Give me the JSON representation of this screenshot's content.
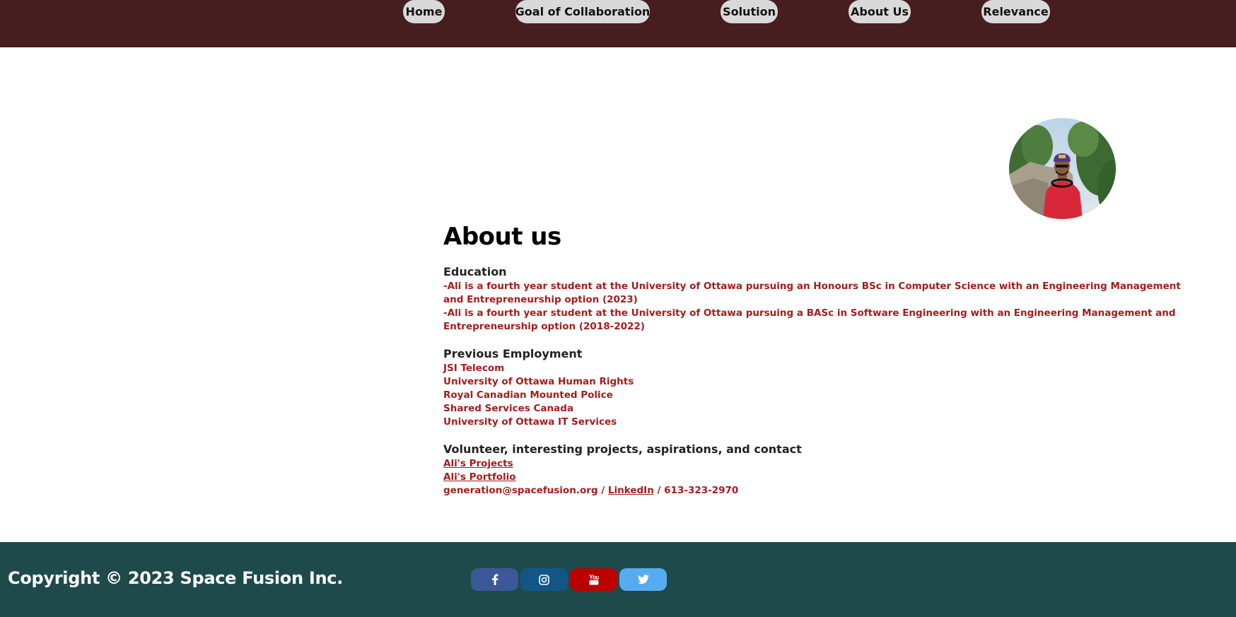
{
  "nav": {
    "items": [
      {
        "label": "Home"
      },
      {
        "label": "Goal of Collaboration"
      },
      {
        "label": "Solution"
      },
      {
        "label": "About Us"
      },
      {
        "label": "Relevance"
      }
    ]
  },
  "colors": {
    "header_bg": "#461e1f",
    "nav_button_bg": "#d9d9d9",
    "accent_red": "#a31d1d",
    "footer_bg": "#1f4a4b",
    "facebook": "#3b5998",
    "instagram": "#125688",
    "youtube": "#bb0000",
    "twitter": "#55acee"
  },
  "main": {
    "title": "About us",
    "education": {
      "heading": "Education",
      "lines": [
        "-Ali is a fourth year student at the University of Ottawa pursuing an Honours BSc in Computer Science with an Engineering Management and Entrepreneurship option (2023)",
        "-Ali is a fourth year student at the University of Ottawa pursuing a BASc in Software Engineering with an Engineering Management and Entrepreneurship option (2018-2022)"
      ]
    },
    "employment": {
      "heading": "Previous Employment",
      "items": [
        "JSI Telecom",
        "University of Ottawa Human Rights",
        "Royal Canadian Mounted Police",
        "Shared Services Canada",
        "University of Ottawa IT Services"
      ]
    },
    "volunteer": {
      "heading": "Volunteer, interesting projects, aspirations, and contact",
      "projects_link": "Ali's Projects",
      "portfolio_link": "Ali's Portfolio",
      "email": "generation@spacefusion.org",
      "separator": "/",
      "linkedin_link": "LinkedIn",
      "phone": "613-323-2970"
    }
  },
  "footer": {
    "copyright": "Copyright © 2023 Space Fusion Inc.",
    "social_icons": [
      "facebook-icon",
      "instagram-icon",
      "youtube-icon",
      "twitter-icon"
    ]
  }
}
